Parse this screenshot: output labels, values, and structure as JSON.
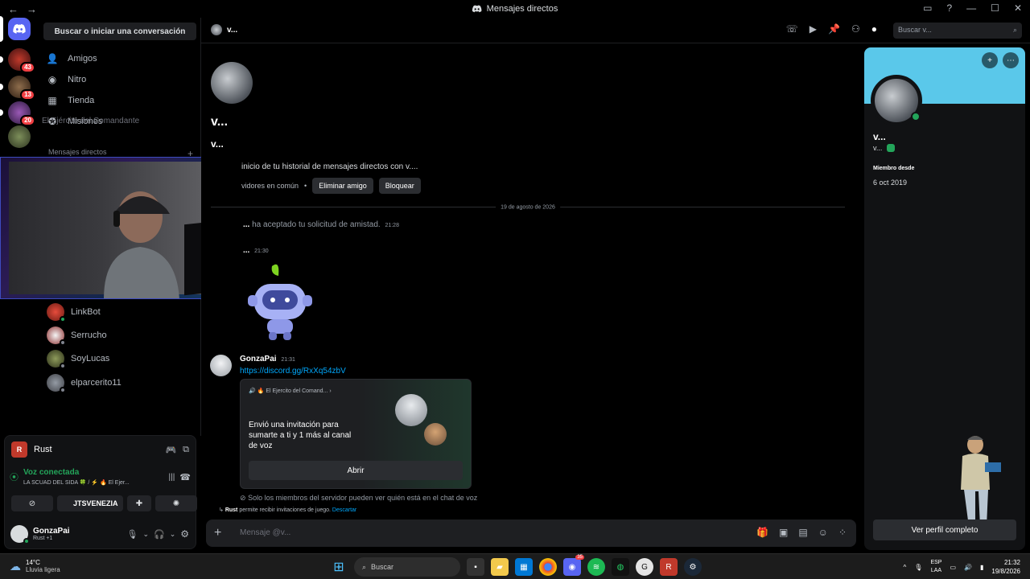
{
  "window": {
    "title": "Mensajes directos",
    "back": "←",
    "forward": "→"
  },
  "dm_sidebar": {
    "search_label": "Buscar o iniciar una conversación",
    "nav": [
      {
        "label": "Amigos",
        "icon": "friends-icon"
      },
      {
        "label": "Nitro",
        "icon": "nitro-icon"
      },
      {
        "label": "Tienda",
        "icon": "shop-icon"
      },
      {
        "label": "Misiones",
        "icon": "quests-icon"
      }
    ],
    "tooltip_server": "El Ejército del Comandante",
    "section_label": "Mensajes directos",
    "add": "+",
    "dms": [
      {
        "name": "LinkBot"
      },
      {
        "name": "Serrucho"
      },
      {
        "name": "SoyLucas"
      },
      {
        "name": "elparcerito11"
      }
    ]
  },
  "guilds": {
    "badges": [
      "43",
      "13",
      "20"
    ]
  },
  "voice_panel": {
    "game": "Rust",
    "status": "Voz conectada",
    "channel": "LA SCUAD DEL SIDA 🍀 / ⚡ 🔥 El Ejer...",
    "overlay_text": "JTSVENEZIA",
    "user": {
      "name": "GonzaPai",
      "sub": "Rust +1"
    }
  },
  "header": {
    "dm_name": "v...",
    "search_placeholder": "Buscar v..."
  },
  "chat": {
    "hero_name": "v...",
    "hero_user": "v...",
    "intro": "inicio de tu historial de mensajes directos con v....",
    "mutual": "vidores en común",
    "remove_friend": "Eliminar amigo",
    "block": "Bloquear",
    "date_divider": "19 de agosto de 2026",
    "system_actor": "...",
    "system_text": "ha aceptado tu solicitud de amistad.",
    "system_time": "21:28",
    "sticker_author": "...",
    "sticker_time": "21:30",
    "message": {
      "author": "GonzaPai",
      "time": "21:31",
      "link": "https://discord.gg/RxXq54zbV"
    },
    "invite": {
      "server": "🔥 El Ejercito del Comand...",
      "text": "Envió una invitación para sumarte a ti y 1 más al canal de voz",
      "button": "Abrir"
    },
    "privacy_note": "Solo los miembros del servidor pueden ver quién está en el chat de voz",
    "game_note_game": "Rust",
    "game_note_text": "permite recibir invitaciones de juego.",
    "game_note_action": "Descartar"
  },
  "composer": {
    "placeholder": "Mensaje @v..."
  },
  "profile": {
    "name": "v...",
    "username": "v...",
    "member_since_label": "Miembro desde",
    "member_since": "6 oct 2019",
    "view_full": "Ver perfil completo"
  },
  "taskbar": {
    "weather_temp": "14°C",
    "weather_desc": "Lluvia ligera",
    "search": "Buscar",
    "lang_1": "ESP",
    "lang_2": "LAA",
    "time": "21:32",
    "date": "19/8/2026",
    "discord_badge": "35"
  },
  "colors": {
    "accent_green": "#23a55a",
    "link": "#00a8fc",
    "profile_banner": "#5ac8ea",
    "badge_red": "#f23f43"
  }
}
